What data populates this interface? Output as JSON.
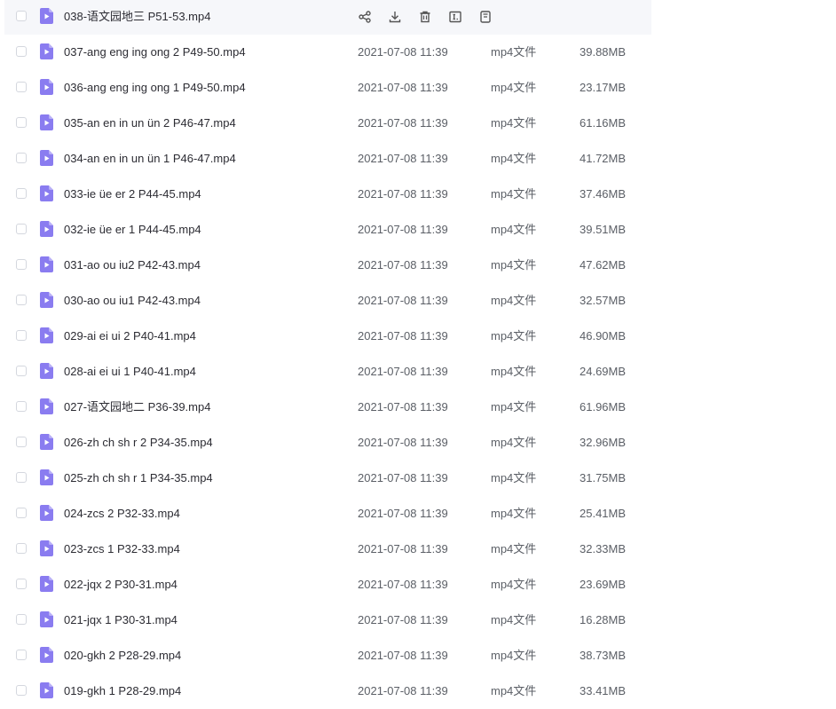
{
  "colors": {
    "accent": "#8a7cf0",
    "row_hover": "#f6f7fa",
    "text_primary": "#2c2c33",
    "text_secondary": "#5b5f66"
  },
  "hovered_actions": [
    "share-icon",
    "download-icon",
    "delete-icon",
    "rename-icon",
    "more-icon"
  ],
  "files": [
    {
      "name": "038-语文园地三 P51-53.mp4",
      "date": "",
      "type": "",
      "size": ""
    },
    {
      "name": "037-ang eng ing ong 2 P49-50.mp4",
      "date": "2021-07-08 11:39",
      "type": "mp4文件",
      "size": "39.88MB"
    },
    {
      "name": "036-ang eng ing ong 1 P49-50.mp4",
      "date": "2021-07-08 11:39",
      "type": "mp4文件",
      "size": "23.17MB"
    },
    {
      "name": "035-an en in un ün 2 P46-47.mp4",
      "date": "2021-07-08 11:39",
      "type": "mp4文件",
      "size": "61.16MB"
    },
    {
      "name": "034-an en in un ün 1 P46-47.mp4",
      "date": "2021-07-08 11:39",
      "type": "mp4文件",
      "size": "41.72MB"
    },
    {
      "name": "033-ie üe er 2 P44-45.mp4",
      "date": "2021-07-08 11:39",
      "type": "mp4文件",
      "size": "37.46MB"
    },
    {
      "name": "032-ie üe er 1 P44-45.mp4",
      "date": "2021-07-08 11:39",
      "type": "mp4文件",
      "size": "39.51MB"
    },
    {
      "name": "031-ao ou iu2 P42-43.mp4",
      "date": "2021-07-08 11:39",
      "type": "mp4文件",
      "size": "47.62MB"
    },
    {
      "name": "030-ao ou iu1 P42-43.mp4",
      "date": "2021-07-08 11:39",
      "type": "mp4文件",
      "size": "32.57MB"
    },
    {
      "name": "029-ai ei ui 2 P40-41.mp4",
      "date": "2021-07-08 11:39",
      "type": "mp4文件",
      "size": "46.90MB"
    },
    {
      "name": "028-ai ei ui 1 P40-41.mp4",
      "date": "2021-07-08 11:39",
      "type": "mp4文件",
      "size": "24.69MB"
    },
    {
      "name": "027-语文园地二 P36-39.mp4",
      "date": "2021-07-08 11:39",
      "type": "mp4文件",
      "size": "61.96MB"
    },
    {
      "name": "026-zh ch sh r 2 P34-35.mp4",
      "date": "2021-07-08 11:39",
      "type": "mp4文件",
      "size": "32.96MB"
    },
    {
      "name": "025-zh ch sh r 1 P34-35.mp4",
      "date": "2021-07-08 11:39",
      "type": "mp4文件",
      "size": "31.75MB"
    },
    {
      "name": "024-zcs 2 P32-33.mp4",
      "date": "2021-07-08 11:39",
      "type": "mp4文件",
      "size": "25.41MB"
    },
    {
      "name": "023-zcs 1 P32-33.mp4",
      "date": "2021-07-08 11:39",
      "type": "mp4文件",
      "size": "32.33MB"
    },
    {
      "name": "022-jqx 2 P30-31.mp4",
      "date": "2021-07-08 11:39",
      "type": "mp4文件",
      "size": "23.69MB"
    },
    {
      "name": "021-jqx 1 P30-31.mp4",
      "date": "2021-07-08 11:39",
      "type": "mp4文件",
      "size": "16.28MB"
    },
    {
      "name": "020-gkh 2 P28-29.mp4",
      "date": "2021-07-08 11:39",
      "type": "mp4文件",
      "size": "38.73MB"
    },
    {
      "name": "019-gkh 1 P28-29.mp4",
      "date": "2021-07-08 11:39",
      "type": "mp4文件",
      "size": "33.41MB"
    }
  ]
}
